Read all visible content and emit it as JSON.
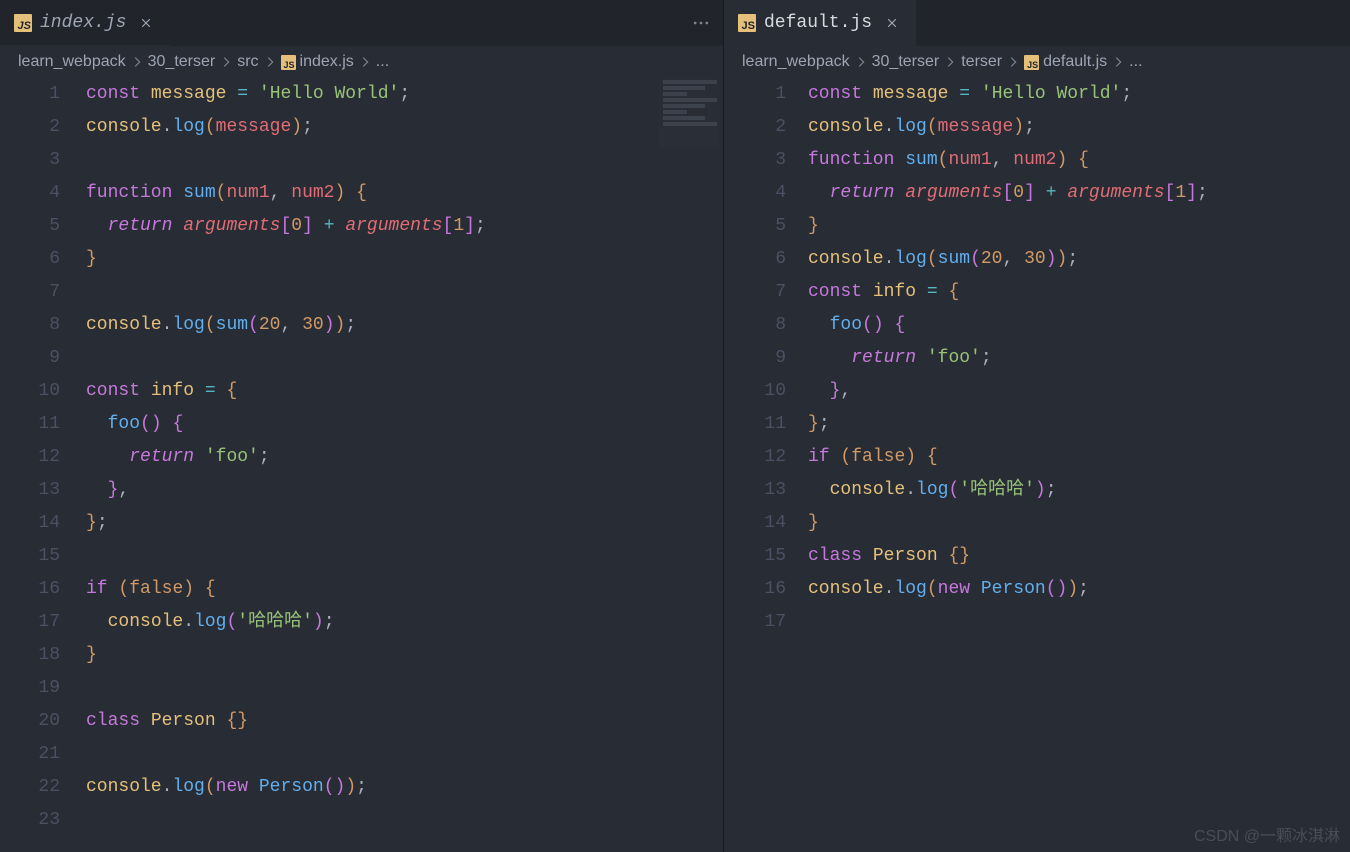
{
  "panes": {
    "left": {
      "tab": {
        "label": "index.js",
        "js_badge": "JS",
        "active": false
      },
      "breadcrumbs": [
        "learn_webpack",
        "30_terser",
        "src",
        {
          "icon": "JS",
          "label": "index.js"
        },
        "..."
      ],
      "line_count": 23
    },
    "right": {
      "tab": {
        "label": "default.js",
        "js_badge": "JS",
        "active": true
      },
      "breadcrumbs": [
        "learn_webpack",
        "30_terser",
        "terser",
        {
          "icon": "JS",
          "label": "default.js"
        },
        "..."
      ],
      "line_count": 17
    }
  },
  "code": {
    "left": [
      [
        [
          "kw",
          "const"
        ],
        [
          "pn",
          " "
        ],
        [
          "varc",
          "message"
        ],
        [
          "pn",
          " "
        ],
        [
          "op",
          "="
        ],
        [
          "pn",
          " "
        ],
        [
          "str",
          "'Hello World'"
        ],
        [
          "pn",
          ";"
        ]
      ],
      [
        [
          "obj",
          "console"
        ],
        [
          "pn",
          "."
        ],
        [
          "fn",
          "log"
        ],
        [
          "br0",
          "("
        ],
        [
          "varr",
          "message"
        ],
        [
          "br0",
          ")"
        ],
        [
          "pn",
          ";"
        ]
      ],
      [],
      [
        [
          "kw",
          "function"
        ],
        [
          "pn",
          " "
        ],
        [
          "fn",
          "sum"
        ],
        [
          "br0",
          "("
        ],
        [
          "varr",
          "num1"
        ],
        [
          "pn",
          ", "
        ],
        [
          "varr",
          "num2"
        ],
        [
          "br0",
          ")"
        ],
        [
          "pn",
          " "
        ],
        [
          "br0",
          "{"
        ]
      ],
      [
        [
          "pn",
          "  "
        ],
        [
          "kw2",
          "return"
        ],
        [
          "pn",
          " "
        ],
        [
          "args",
          "arguments"
        ],
        [
          "br1",
          "["
        ],
        [
          "num",
          "0"
        ],
        [
          "br1",
          "]"
        ],
        [
          "pn",
          " "
        ],
        [
          "op",
          "+"
        ],
        [
          "pn",
          " "
        ],
        [
          "args",
          "arguments"
        ],
        [
          "br1",
          "["
        ],
        [
          "num",
          "1"
        ],
        [
          "br1",
          "]"
        ],
        [
          "pn",
          ";"
        ]
      ],
      [
        [
          "br0",
          "}"
        ]
      ],
      [],
      [
        [
          "obj",
          "console"
        ],
        [
          "pn",
          "."
        ],
        [
          "fn",
          "log"
        ],
        [
          "br0",
          "("
        ],
        [
          "fn",
          "sum"
        ],
        [
          "br1",
          "("
        ],
        [
          "num",
          "20"
        ],
        [
          "pn",
          ", "
        ],
        [
          "num",
          "30"
        ],
        [
          "br1",
          ")"
        ],
        [
          "br0",
          ")"
        ],
        [
          "pn",
          ";"
        ]
      ],
      [],
      [
        [
          "kw",
          "const"
        ],
        [
          "pn",
          " "
        ],
        [
          "varc",
          "info"
        ],
        [
          "pn",
          " "
        ],
        [
          "op",
          "="
        ],
        [
          "pn",
          " "
        ],
        [
          "br0",
          "{"
        ]
      ],
      [
        [
          "pn",
          "  "
        ],
        [
          "fn",
          "foo"
        ],
        [
          "br1",
          "("
        ],
        [
          "br1",
          ")"
        ],
        [
          "pn",
          " "
        ],
        [
          "br1",
          "{"
        ]
      ],
      [
        [
          "pn",
          "    "
        ],
        [
          "kw2",
          "return"
        ],
        [
          "pn",
          " "
        ],
        [
          "str",
          "'foo'"
        ],
        [
          "pn",
          ";"
        ]
      ],
      [
        [
          "pn",
          "  "
        ],
        [
          "br1",
          "}"
        ],
        [
          "pn",
          ","
        ]
      ],
      [
        [
          "br0",
          "}"
        ],
        [
          "pn",
          ";"
        ]
      ],
      [],
      [
        [
          "kw",
          "if"
        ],
        [
          "pn",
          " "
        ],
        [
          "br0",
          "("
        ],
        [
          "bool",
          "false"
        ],
        [
          "br0",
          ")"
        ],
        [
          "pn",
          " "
        ],
        [
          "br0",
          "{"
        ]
      ],
      [
        [
          "pn",
          "  "
        ],
        [
          "obj",
          "console"
        ],
        [
          "pn",
          "."
        ],
        [
          "fn",
          "log"
        ],
        [
          "br1",
          "("
        ],
        [
          "str",
          "'哈哈哈'"
        ],
        [
          "br1",
          ")"
        ],
        [
          "pn",
          ";"
        ]
      ],
      [
        [
          "br0",
          "}"
        ]
      ],
      [],
      [
        [
          "kw",
          "class"
        ],
        [
          "pn",
          " "
        ],
        [
          "varc",
          "Person"
        ],
        [
          "pn",
          " "
        ],
        [
          "br0",
          "{"
        ],
        [
          "br0",
          "}"
        ]
      ],
      [],
      [
        [
          "obj",
          "console"
        ],
        [
          "pn",
          "."
        ],
        [
          "fn",
          "log"
        ],
        [
          "br0",
          "("
        ],
        [
          "kw",
          "new"
        ],
        [
          "pn",
          " "
        ],
        [
          "fn",
          "Person"
        ],
        [
          "br1",
          "("
        ],
        [
          "br1",
          ")"
        ],
        [
          "br0",
          ")"
        ],
        [
          "pn",
          ";"
        ]
      ],
      []
    ],
    "right": [
      [
        [
          "kw",
          "const"
        ],
        [
          "pn",
          " "
        ],
        [
          "varc",
          "message"
        ],
        [
          "pn",
          " "
        ],
        [
          "op",
          "="
        ],
        [
          "pn",
          " "
        ],
        [
          "str",
          "'Hello World'"
        ],
        [
          "pn",
          ";"
        ]
      ],
      [
        [
          "obj",
          "console"
        ],
        [
          "pn",
          "."
        ],
        [
          "fn",
          "log"
        ],
        [
          "br0",
          "("
        ],
        [
          "varr",
          "message"
        ],
        [
          "br0",
          ")"
        ],
        [
          "pn",
          ";"
        ]
      ],
      [
        [
          "kw",
          "function"
        ],
        [
          "pn",
          " "
        ],
        [
          "fn",
          "sum"
        ],
        [
          "br0",
          "("
        ],
        [
          "varr",
          "num1"
        ],
        [
          "pn",
          ", "
        ],
        [
          "varr",
          "num2"
        ],
        [
          "br0",
          ")"
        ],
        [
          "pn",
          " "
        ],
        [
          "br0",
          "{"
        ]
      ],
      [
        [
          "pn",
          "  "
        ],
        [
          "kw2",
          "return"
        ],
        [
          "pn",
          " "
        ],
        [
          "args",
          "arguments"
        ],
        [
          "br1",
          "["
        ],
        [
          "num",
          "0"
        ],
        [
          "br1",
          "]"
        ],
        [
          "pn",
          " "
        ],
        [
          "op",
          "+"
        ],
        [
          "pn",
          " "
        ],
        [
          "args",
          "arguments"
        ],
        [
          "br1",
          "["
        ],
        [
          "num",
          "1"
        ],
        [
          "br1",
          "]"
        ],
        [
          "pn",
          ";"
        ]
      ],
      [
        [
          "br0",
          "}"
        ]
      ],
      [
        [
          "obj",
          "console"
        ],
        [
          "pn",
          "."
        ],
        [
          "fn",
          "log"
        ],
        [
          "br0",
          "("
        ],
        [
          "fn",
          "sum"
        ],
        [
          "br1",
          "("
        ],
        [
          "num",
          "20"
        ],
        [
          "pn",
          ", "
        ],
        [
          "num",
          "30"
        ],
        [
          "br1",
          ")"
        ],
        [
          "br0",
          ")"
        ],
        [
          "pn",
          ";"
        ]
      ],
      [
        [
          "kw",
          "const"
        ],
        [
          "pn",
          " "
        ],
        [
          "varc",
          "info"
        ],
        [
          "pn",
          " "
        ],
        [
          "op",
          "="
        ],
        [
          "pn",
          " "
        ],
        [
          "br0",
          "{"
        ]
      ],
      [
        [
          "pn",
          "  "
        ],
        [
          "fn",
          "foo"
        ],
        [
          "br1",
          "("
        ],
        [
          "br1",
          ")"
        ],
        [
          "pn",
          " "
        ],
        [
          "br1",
          "{"
        ]
      ],
      [
        [
          "pn",
          "    "
        ],
        [
          "kw2",
          "return"
        ],
        [
          "pn",
          " "
        ],
        [
          "str",
          "'foo'"
        ],
        [
          "pn",
          ";"
        ]
      ],
      [
        [
          "pn",
          "  "
        ],
        [
          "br1",
          "}"
        ],
        [
          "pn",
          ","
        ]
      ],
      [
        [
          "br0",
          "}"
        ],
        [
          "pn",
          ";"
        ]
      ],
      [
        [
          "kw",
          "if"
        ],
        [
          "pn",
          " "
        ],
        [
          "br0",
          "("
        ],
        [
          "bool",
          "false"
        ],
        [
          "br0",
          ")"
        ],
        [
          "pn",
          " "
        ],
        [
          "br0",
          "{"
        ]
      ],
      [
        [
          "pn",
          "  "
        ],
        [
          "obj",
          "console"
        ],
        [
          "pn",
          "."
        ],
        [
          "fn",
          "log"
        ],
        [
          "br1",
          "("
        ],
        [
          "str",
          "'哈哈哈'"
        ],
        [
          "br1",
          ")"
        ],
        [
          "pn",
          ";"
        ]
      ],
      [
        [
          "br0",
          "}"
        ]
      ],
      [
        [
          "kw",
          "class"
        ],
        [
          "pn",
          " "
        ],
        [
          "varc",
          "Person"
        ],
        [
          "pn",
          " "
        ],
        [
          "br0",
          "{"
        ],
        [
          "br0",
          "}"
        ]
      ],
      [
        [
          "obj",
          "console"
        ],
        [
          "pn",
          "."
        ],
        [
          "fn",
          "log"
        ],
        [
          "br0",
          "("
        ],
        [
          "kw",
          "new"
        ],
        [
          "pn",
          " "
        ],
        [
          "fn",
          "Person"
        ],
        [
          "br1",
          "("
        ],
        [
          "br1",
          ")"
        ],
        [
          "br0",
          ")"
        ],
        [
          "pn",
          ";"
        ]
      ],
      []
    ]
  },
  "watermark": "CSDN @一颗冰淇淋"
}
